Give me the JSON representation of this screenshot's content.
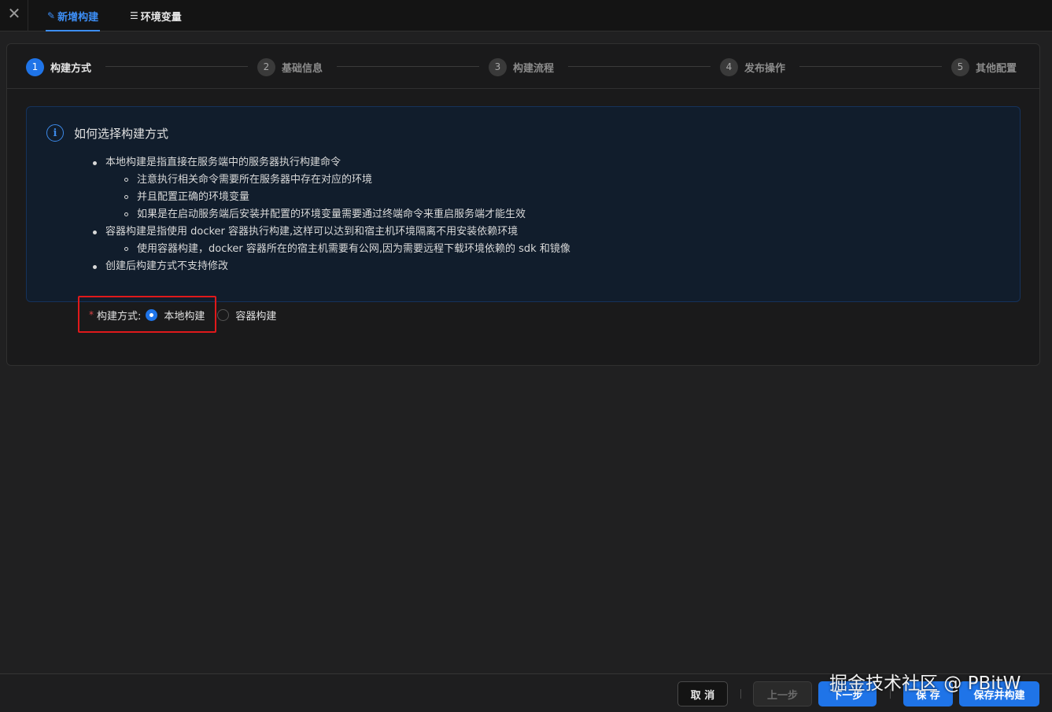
{
  "topbar": {
    "close_glyph": "✕",
    "tabs": [
      {
        "icon": "edit-icon",
        "glyph": "✎",
        "label": "新增构建",
        "active": true
      },
      {
        "icon": "list-icon",
        "glyph": "☰",
        "label": "环境变量",
        "active": false
      }
    ]
  },
  "steps": [
    {
      "num": "1",
      "title": "构建方式",
      "active": true
    },
    {
      "num": "2",
      "title": "基础信息",
      "active": false
    },
    {
      "num": "3",
      "title": "构建流程",
      "active": false
    },
    {
      "num": "4",
      "title": "发布操作",
      "active": false
    },
    {
      "num": "5",
      "title": "其他配置",
      "active": false
    }
  ],
  "alert": {
    "icon": "info-icon",
    "glyph": "i",
    "title": "如何选择构建方式",
    "items": [
      "本地构建是指直接在服务端中的服务器执行构建命令",
      "注意执行相关命令需要所在服务器中存在对应的环境",
      "并且配置正确的环境变量",
      "如果是在启动服务端后安装并配置的环境变量需要通过终端命令来重启服务端才能生效",
      "容器构建是指使用 docker 容器执行构建,这样可以达到和宿主机环境隔离不用安装依赖环境",
      "使用容器构建，docker 容器所在的宿主机需要有公网,因为需要远程下载环境依赖的 sdk 和镜像",
      "创建后构建方式不支持修改"
    ]
  },
  "form": {
    "required_mark": "*",
    "label": "构建方式:",
    "options": [
      {
        "label": "本地构建",
        "checked": true
      },
      {
        "label": "容器构建",
        "checked": false
      }
    ]
  },
  "footer": {
    "cancel": "取 消",
    "prev": "上一步",
    "next": "下一步",
    "save": "保 存",
    "save_build": "保存并构建"
  },
  "watermark": "掘金技术社区 @ PBitW",
  "colors": {
    "accent": "#1f74e8",
    "background": "#202021",
    "alert_bg": "#111d2c",
    "highlight": "#e0191b"
  }
}
